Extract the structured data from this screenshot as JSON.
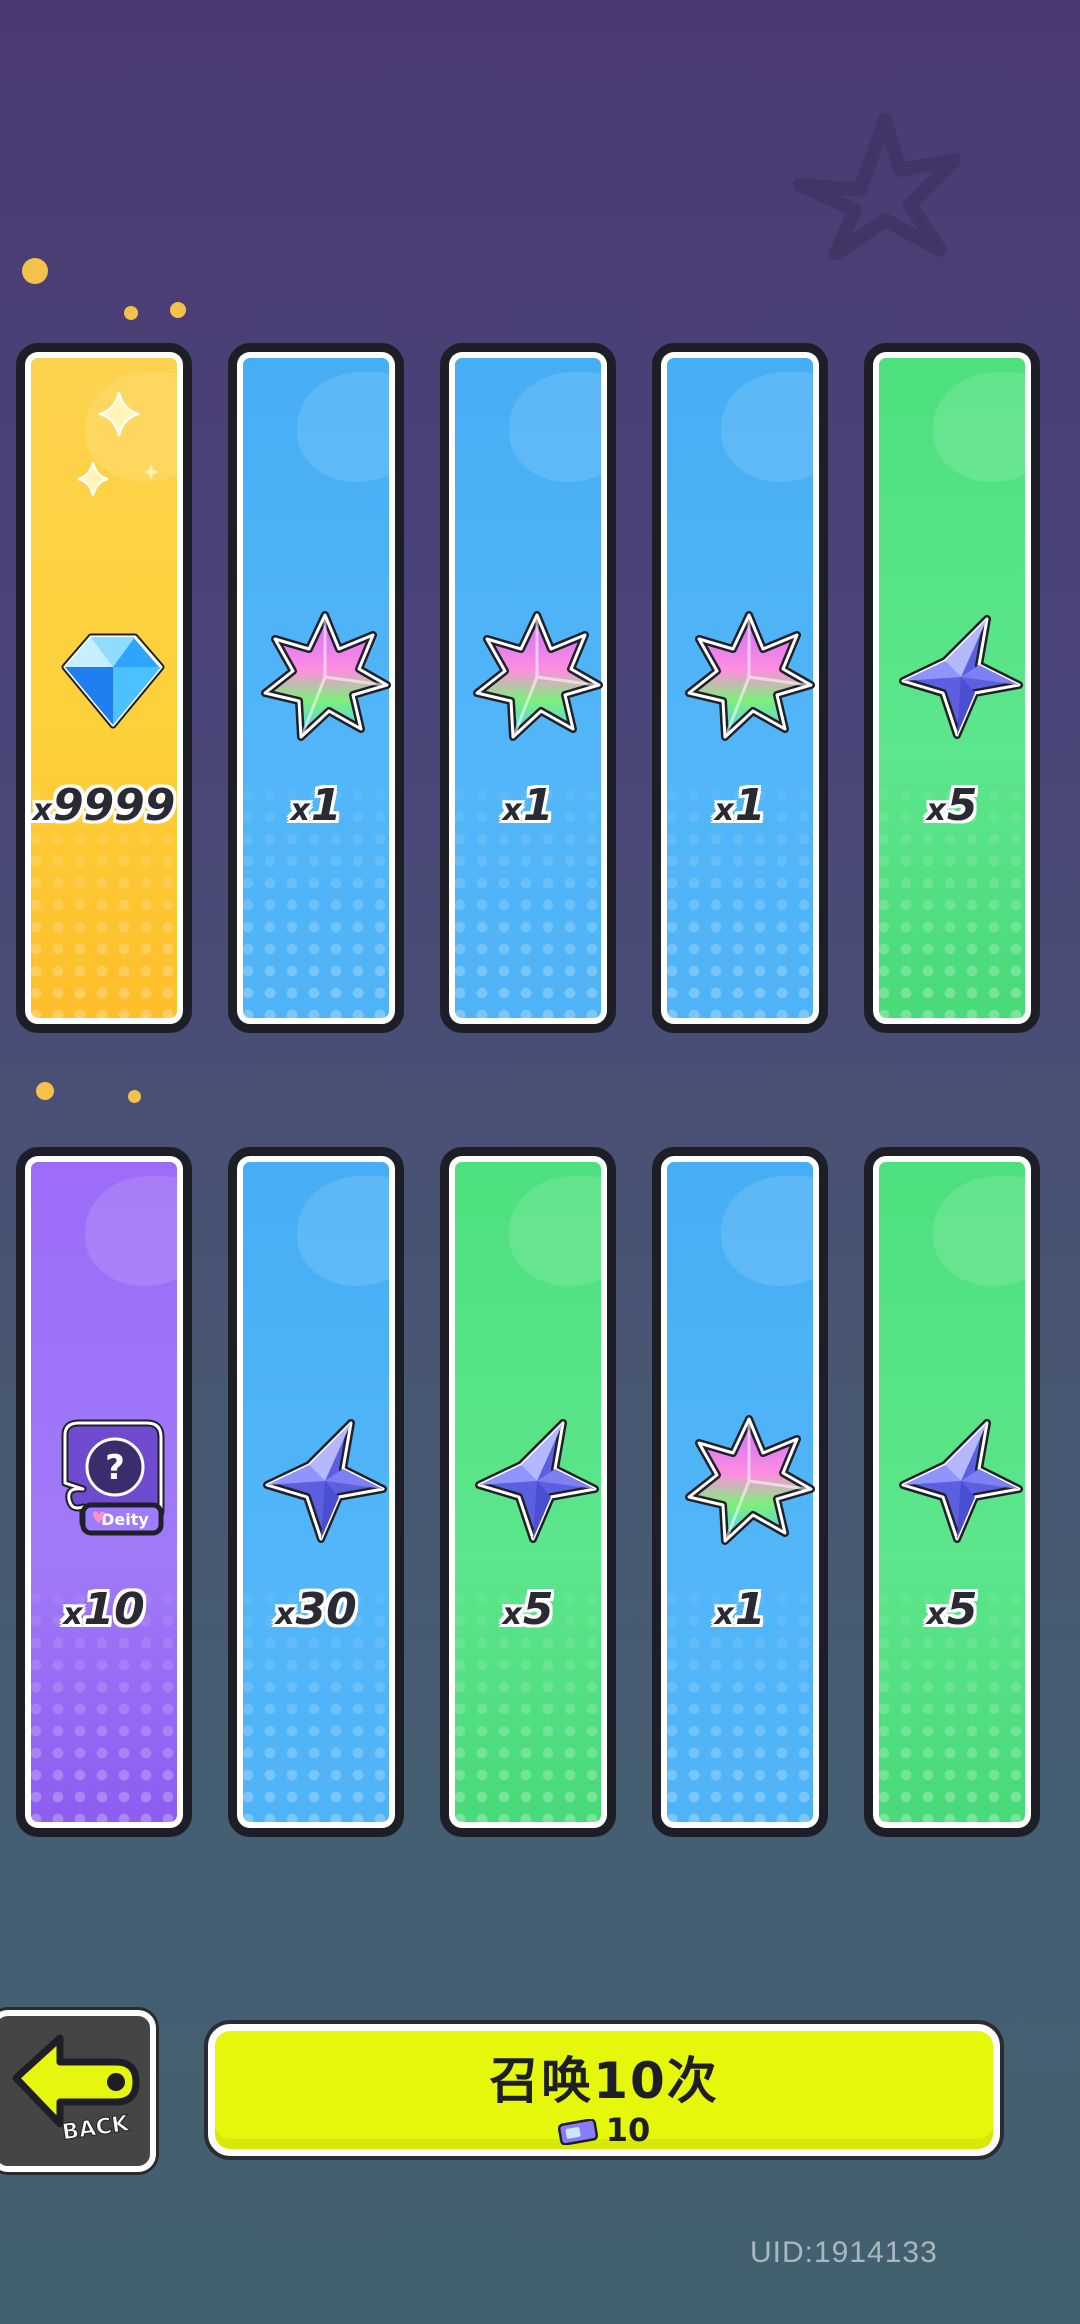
{
  "cards_row1": [
    {
      "rarity": "gold",
      "item": "diamond-icon",
      "x": "x",
      "qty": "9999"
    },
    {
      "rarity": "blue",
      "item": "rainbow-star-icon",
      "x": "x",
      "qty": "1"
    },
    {
      "rarity": "blue",
      "item": "rainbow-star-icon",
      "x": "x",
      "qty": "1"
    },
    {
      "rarity": "blue",
      "item": "rainbow-star-icon",
      "x": "x",
      "qty": "1"
    },
    {
      "rarity": "green",
      "item": "blue-star-icon",
      "x": "x",
      "qty": "5"
    }
  ],
  "cards_row2": [
    {
      "rarity": "purple",
      "item": "mystery-deity-puzzle-icon",
      "x": "x",
      "qty": "10",
      "badge": "Deity",
      "glyph": "?"
    },
    {
      "rarity": "blue",
      "item": "blue-star-icon",
      "x": "x",
      "qty": "30"
    },
    {
      "rarity": "green",
      "item": "blue-star-icon",
      "x": "x",
      "qty": "5"
    },
    {
      "rarity": "blue",
      "item": "rainbow-star-icon",
      "x": "x",
      "qty": "1"
    },
    {
      "rarity": "green",
      "item": "blue-star-icon",
      "x": "x",
      "qty": "5"
    }
  ],
  "back_button": {
    "label": "BACK"
  },
  "summon_button": {
    "title": "召唤10次",
    "cost": "10",
    "cost_icon": "ticket-icon"
  },
  "footer": {
    "uid": "UID:1914133"
  },
  "colors": {
    "gold": "#fdd24e",
    "blue": "#4fb4f7",
    "green": "#52e083",
    "purple": "#9c6cf8",
    "summon": "#e5f80c",
    "outline": "#1e1e26"
  }
}
